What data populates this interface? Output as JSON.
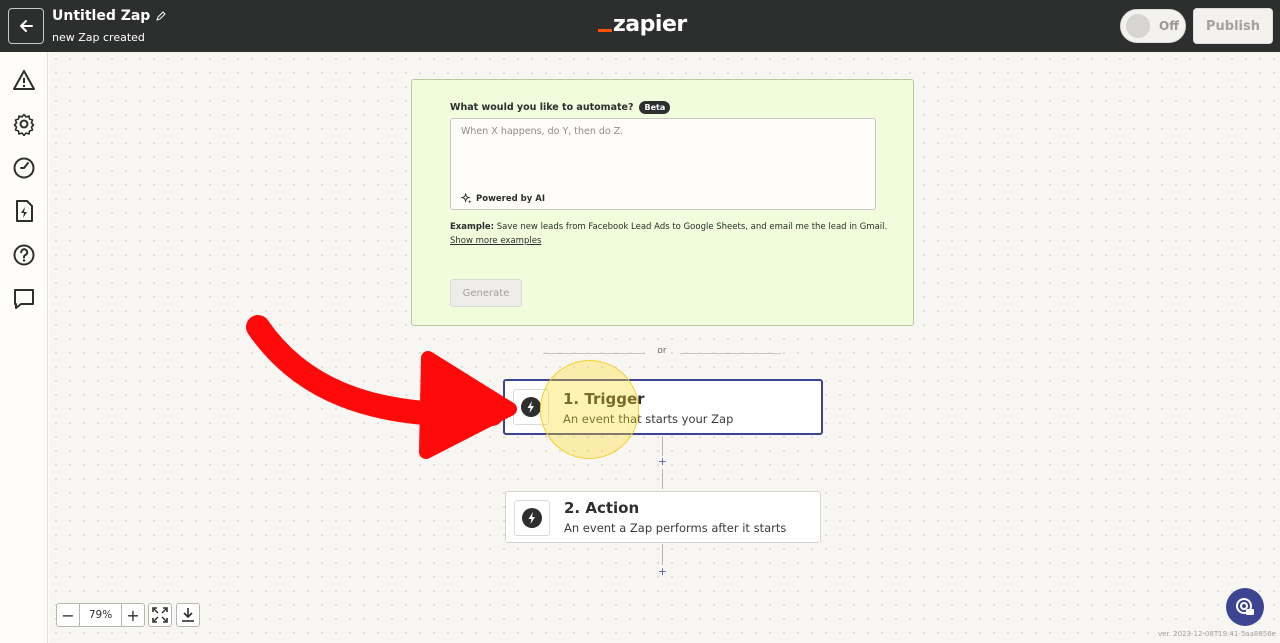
{
  "header": {
    "zap_title": "Untitled Zap",
    "zap_subtitle": "new Zap created",
    "logo_text": "zapier",
    "toggle_label": "Off",
    "publish_label": "Publish"
  },
  "sidebar": {
    "icons": [
      "warning-icon",
      "gear-icon",
      "clock-icon",
      "file-bolt-icon",
      "help-circle-icon",
      "chat-icon"
    ]
  },
  "ai_panel": {
    "question": "What would you like to automate?",
    "badge": "Beta",
    "placeholder": "When X happens, do Y, then do Z.",
    "powered_by": "Powered by AI",
    "example_label": "Example:",
    "example_text": " Save new leads from Facebook Lead Ads to Google Sheets, and email me the lead in Gmail.",
    "show_more": "Show more examples",
    "generate_label": "Generate"
  },
  "divider": {
    "text": "or"
  },
  "steps": [
    {
      "title": "1. Trigger",
      "subtitle": "An event that starts your Zap"
    },
    {
      "title": "2. Action",
      "subtitle": "An event a Zap performs after it starts"
    }
  ],
  "add_step": {
    "symbol": "+"
  },
  "zoom": {
    "minus": "−",
    "value": "79%",
    "plus": "+"
  },
  "version": "ver. 2023-12-08T19:41-5aa8856e",
  "colors": {
    "header_bg": "#2d2e2e",
    "accent": "#ff4f00",
    "selected_border": "#3d4592",
    "ai_panel_bg": "#f0fcdc",
    "annotation_arrow": "#ff0a0a",
    "highlight": "#f3cf2a"
  }
}
